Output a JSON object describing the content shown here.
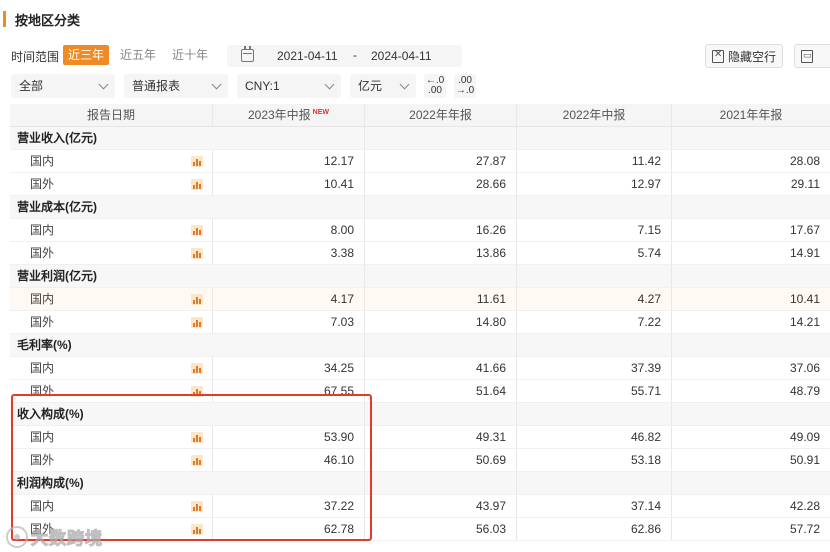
{
  "section_title": "按地区分类",
  "time_range": {
    "label": "时间范围",
    "options": [
      "近三年",
      "近五年",
      "近十年"
    ],
    "active": "近三年",
    "date_from": "2021-04-11",
    "date_sep": "-",
    "date_to": "2024-04-11"
  },
  "toolbar": {
    "hide_empty_label": "隐藏空行"
  },
  "filters": {
    "scope": "全部",
    "report_type": "普通报表",
    "currency": "CNY:1",
    "unit": "亿元",
    "precision_dec_top": "←.0",
    "precision_dec_bottom": ".00",
    "precision_inc_top": ".00",
    "precision_inc_bottom": "→.0"
  },
  "table": {
    "header": {
      "label": "报告日期",
      "periods": [
        "2023年中报",
        "2022年年报",
        "2022年中报",
        "2021年年报"
      ],
      "new_tag": "NEW"
    },
    "sections": [
      {
        "title": "营业收入(亿元)",
        "rows": [
          {
            "label": "国内",
            "values": [
              "12.17",
              "27.87",
              "11.42",
              "28.08"
            ]
          },
          {
            "label": "国外",
            "values": [
              "10.41",
              "28.66",
              "12.97",
              "29.11"
            ]
          }
        ]
      },
      {
        "title": "营业成本(亿元)",
        "rows": [
          {
            "label": "国内",
            "values": [
              "8.00",
              "16.26",
              "7.15",
              "17.67"
            ]
          },
          {
            "label": "国外",
            "values": [
              "3.38",
              "13.86",
              "5.74",
              "14.91"
            ]
          }
        ]
      },
      {
        "title": "营业利润(亿元)",
        "rows": [
          {
            "label": "国内",
            "values": [
              "4.17",
              "11.61",
              "4.27",
              "10.41"
            ]
          },
          {
            "label": "国外",
            "values": [
              "7.03",
              "14.80",
              "7.22",
              "14.21"
            ]
          }
        ]
      },
      {
        "title": "毛利率(%)",
        "rows": [
          {
            "label": "国内",
            "values": [
              "34.25",
              "41.66",
              "37.39",
              "37.06"
            ]
          },
          {
            "label": "国外",
            "values": [
              "67.55",
              "51.64",
              "55.71",
              "48.79"
            ]
          }
        ]
      },
      {
        "title": "收入构成(%)",
        "rows": [
          {
            "label": "国内",
            "values": [
              "53.90",
              "49.31",
              "46.82",
              "49.09"
            ]
          },
          {
            "label": "国外",
            "values": [
              "46.10",
              "50.69",
              "53.18",
              "50.91"
            ]
          }
        ]
      },
      {
        "title": "利润构成(%)",
        "rows": [
          {
            "label": "国内",
            "values": [
              "37.22",
              "43.97",
              "37.14",
              "42.28"
            ]
          },
          {
            "label": "国外",
            "values": [
              "62.78",
              "56.03",
              "62.86",
              "57.72"
            ]
          }
        ]
      }
    ]
  },
  "watermark": "大数跨境",
  "colors": {
    "accent": "#f08a24",
    "highlight_box": "#e23b2e",
    "new_tag": "#e62d2d"
  }
}
